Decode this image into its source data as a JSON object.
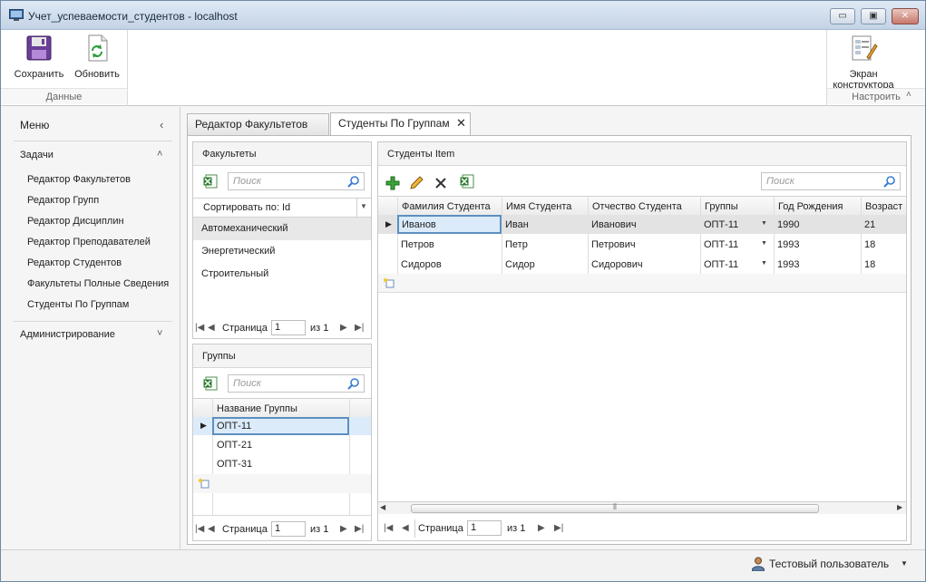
{
  "window": {
    "title": "Учет_успеваемости_студентов - localhost",
    "min_label": "▭",
    "restore_label": "▣",
    "close_label": "✕"
  },
  "ribbon": {
    "save_label": "Сохранить",
    "refresh_label": "Обновить",
    "group_data": "Данные",
    "designer_label_line1": "Экран",
    "designer_label_line2": "конструктора",
    "group_configure": "Настроить"
  },
  "nav": {
    "menu_label": "Меню",
    "tasks_label": "Задачи",
    "items": [
      {
        "label": "Редактор Факультетов"
      },
      {
        "label": "Редактор Групп"
      },
      {
        "label": "Редактор Дисциплин"
      },
      {
        "label": "Редактор Преподавателей"
      },
      {
        "label": "Редактор Студентов"
      },
      {
        "label": "Факультеты Полные Сведения"
      },
      {
        "label": "Студенты По Группам"
      }
    ],
    "admin_label": "Администрирование"
  },
  "tabs": [
    {
      "label": "Редактор Факультетов"
    },
    {
      "label": "Студенты По Группам"
    }
  ],
  "faculties": {
    "title": "Факультеты",
    "search_placeholder": "Поиск",
    "sort_label": "Сортировать по: Id",
    "items": [
      "Автомеханический",
      "Энергетический",
      "Строительный"
    ],
    "pager": {
      "page_label": "Страница",
      "page": "1",
      "of_label": "из 1"
    }
  },
  "groups": {
    "title": "Группы",
    "search_placeholder": "Поиск",
    "column": "Название Группы",
    "items": [
      "ОПТ-11",
      "ОПТ-21",
      "ОПТ-31"
    ],
    "pager": {
      "page_label": "Страница",
      "page": "1",
      "of_label": "из 1"
    }
  },
  "students": {
    "title": "Студенты Item",
    "search_placeholder": "Поиск",
    "columns": [
      "Фамилия Студента",
      "Имя Студента",
      "Отчество Студента",
      "Группы",
      "Год Рождения",
      "Возраст"
    ],
    "rows": [
      [
        "Иванов",
        "Иван",
        "Иванович",
        "ОПТ-11",
        "1990",
        "21"
      ],
      [
        "Петров",
        "Петр",
        "Петрович",
        "ОПТ-11",
        "1993",
        "18"
      ],
      [
        "Сидоров",
        "Сидор",
        "Сидорович",
        "ОПТ-11",
        "1993",
        "18"
      ]
    ],
    "pager": {
      "page_label": "Страница",
      "page": "1",
      "of_label": "из 1"
    }
  },
  "status": {
    "user_label": "Тестовый пользователь"
  },
  "colors": {
    "selection": "#dcebfa",
    "accent": "#3a7bd5"
  }
}
